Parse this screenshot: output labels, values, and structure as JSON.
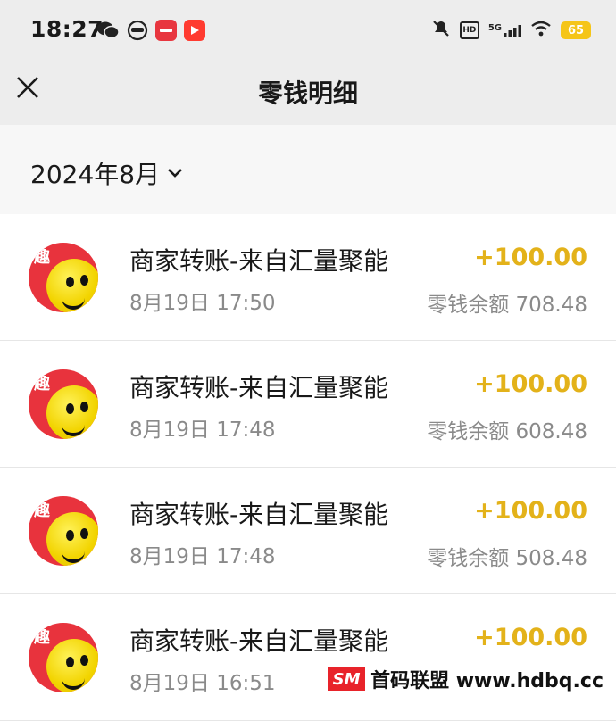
{
  "status_bar": {
    "time": "18:27",
    "battery": "65",
    "network": "5G",
    "hd_badge": "HD"
  },
  "header": {
    "title": "零钱明细"
  },
  "month_filter": {
    "label": "2024年8月"
  },
  "transactions": [
    {
      "title": "商家转账-来自汇量聚能",
      "time": "8月19日 17:50",
      "amount": "+100.00",
      "balance": "零钱余额 708.48"
    },
    {
      "title": "商家转账-来自汇量聚能",
      "time": "8月19日 17:48",
      "amount": "+100.00",
      "balance": "零钱余额 608.48"
    },
    {
      "title": "商家转账-来自汇量聚能",
      "time": "8月19日 17:48",
      "amount": "+100.00",
      "balance": "零钱余额 508.48"
    },
    {
      "title": "商家转账-来自汇量聚能",
      "time": "8月19日 16:51",
      "amount": "+100.00",
      "balance": ""
    }
  ],
  "avatar_char": "趣",
  "watermark": {
    "logo": "SM",
    "text": "首码联盟 www.hdbq.cc"
  },
  "colors": {
    "amount": "#e3b21a",
    "background": "#ededed",
    "avatar_red": "#e8333d"
  }
}
